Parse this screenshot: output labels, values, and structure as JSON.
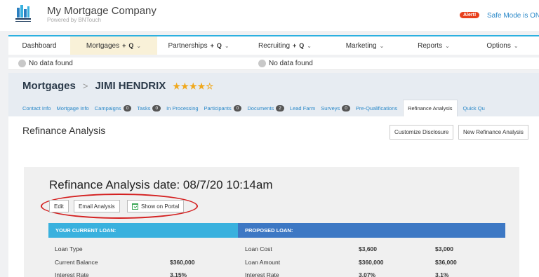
{
  "app": {
    "brand": "My Mortgage Company",
    "brand_sub": "Powered by BNTouch",
    "alert_label": "Alert!",
    "safe_mode": "Safe Mode is ON"
  },
  "nav": {
    "items": [
      {
        "label": "Dashboard",
        "extras": false
      },
      {
        "label": "Mortgages",
        "extras": true,
        "active": true
      },
      {
        "label": "Partnerships",
        "extras": true
      },
      {
        "label": "Recruiting",
        "extras": true
      },
      {
        "label": "Marketing",
        "extras": false
      },
      {
        "label": "Reports",
        "extras": false
      },
      {
        "label": "Options",
        "extras": false
      }
    ],
    "plus": "+",
    "search": "Q",
    "chevron": "⌄"
  },
  "nodata": {
    "left": "No data found",
    "right": "No data found"
  },
  "breadcrumb": {
    "section": "Mortgages",
    "sep": ">",
    "name": "JIMI HENDRIX",
    "stars": "★★★★☆"
  },
  "subtabs": [
    {
      "label": "Contact Info"
    },
    {
      "label": "Mortgage Info"
    },
    {
      "label": "Campaigns",
      "count": "0"
    },
    {
      "label": "Tasks",
      "count": "0"
    },
    {
      "label": "In Processing"
    },
    {
      "label": "Participants",
      "count": "0"
    },
    {
      "label": "Documents",
      "count": "2"
    },
    {
      "label": "Lead Farm"
    },
    {
      "label": "Surveys",
      "count": "0"
    },
    {
      "label": "Pre-Qualifications"
    },
    {
      "label": "Refinance Analysis",
      "active": true
    },
    {
      "label": "Quick Qu"
    }
  ],
  "page": {
    "title": "Refinance Analysis",
    "customize_btn": "Customize Disclosure",
    "new_btn": "New Refinance Analysis"
  },
  "analysis": {
    "date_label": "Refinance Analysis date: 08/7/20 10:14am",
    "edit_btn": "Edit",
    "email_btn": "Email Analysis",
    "portal_btn": "Show on Portal",
    "current_header": "YOUR CURRENT LOAN:",
    "proposed_header": "PROPOSED LOAN:",
    "rows": [
      {
        "c_label": "Loan Type",
        "c_val": "",
        "p_label": "Loan Cost",
        "p_val1": "$3,600",
        "p_val2": "$3,000"
      },
      {
        "c_label": "Current Balance",
        "c_val": "$360,000",
        "p_label": "Loan Amount",
        "p_val1": "$360,000",
        "p_val2": "$36,000"
      },
      {
        "c_label": "Interest Rate",
        "c_val": "3.15%",
        "p_label": "Interest Rate",
        "p_val1": "3.07%",
        "p_val2": "3.1%"
      }
    ]
  },
  "colors": {
    "accent": "#2bb0e0",
    "current_header": "#39b1de",
    "proposed_header": "#3d78c4",
    "alert": "#e8401c",
    "annotation": "#d42020"
  }
}
